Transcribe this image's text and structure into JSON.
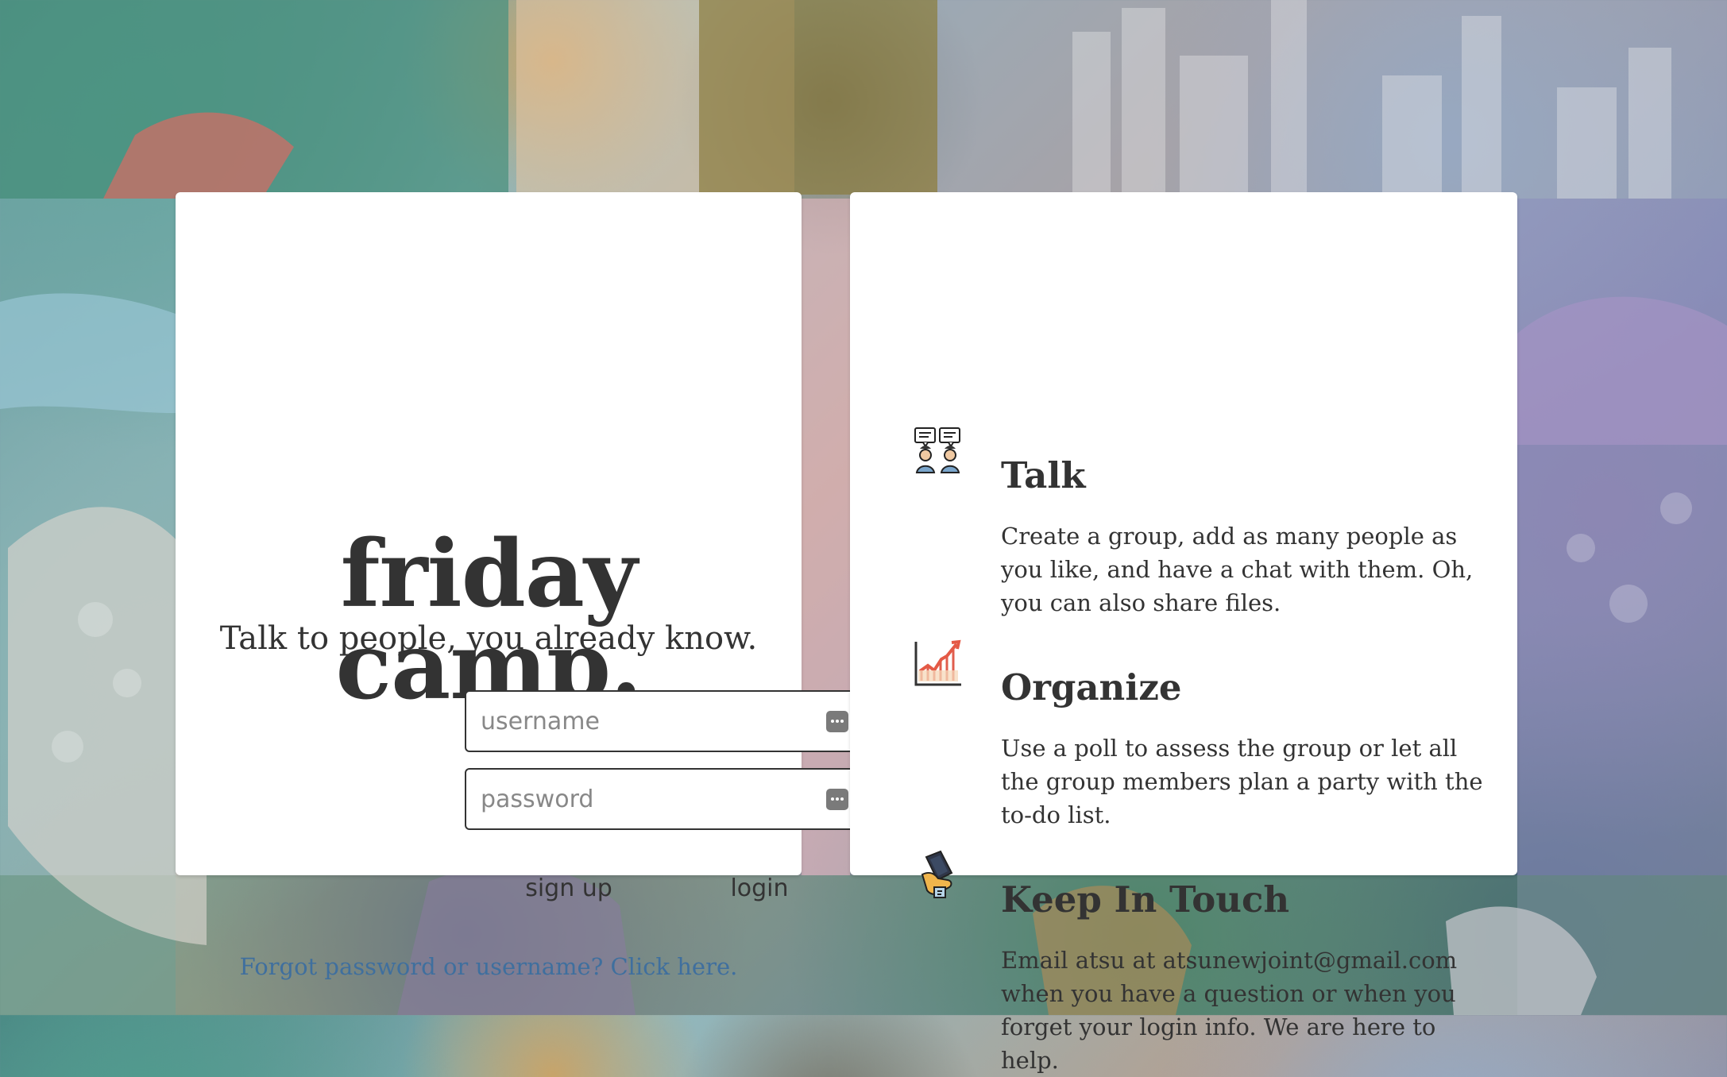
{
  "login": {
    "brand_title": "friday camp.",
    "tagline": "Talk to people, you already know.",
    "username_placeholder": "username",
    "password_placeholder": "password",
    "signup_label": "sign up",
    "login_label": "login",
    "forgot_text": "Forgot password or username? Click here."
  },
  "features": {
    "talk": {
      "icon": "people-chat-icon",
      "title": "Talk",
      "description": "Create a group, add as many people as you like, and have a chat with them. Oh, you can also share files."
    },
    "organize": {
      "icon": "growth-chart-icon",
      "title": "Organize",
      "description": "Use a poll to assess the group or let all the group members plan a party with the to-do list."
    },
    "keep_in_touch": {
      "icon": "phone-hand-icon",
      "title": "Keep In Touch",
      "description": "Email atsu at atsunewjoint@gmail.com when you have a question or when you forget your login info. We are here to help."
    }
  },
  "colors": {
    "card": "#ffffff",
    "text": "#333333",
    "link": "#3f6f9e",
    "field_icon": "#7a7a7a"
  }
}
